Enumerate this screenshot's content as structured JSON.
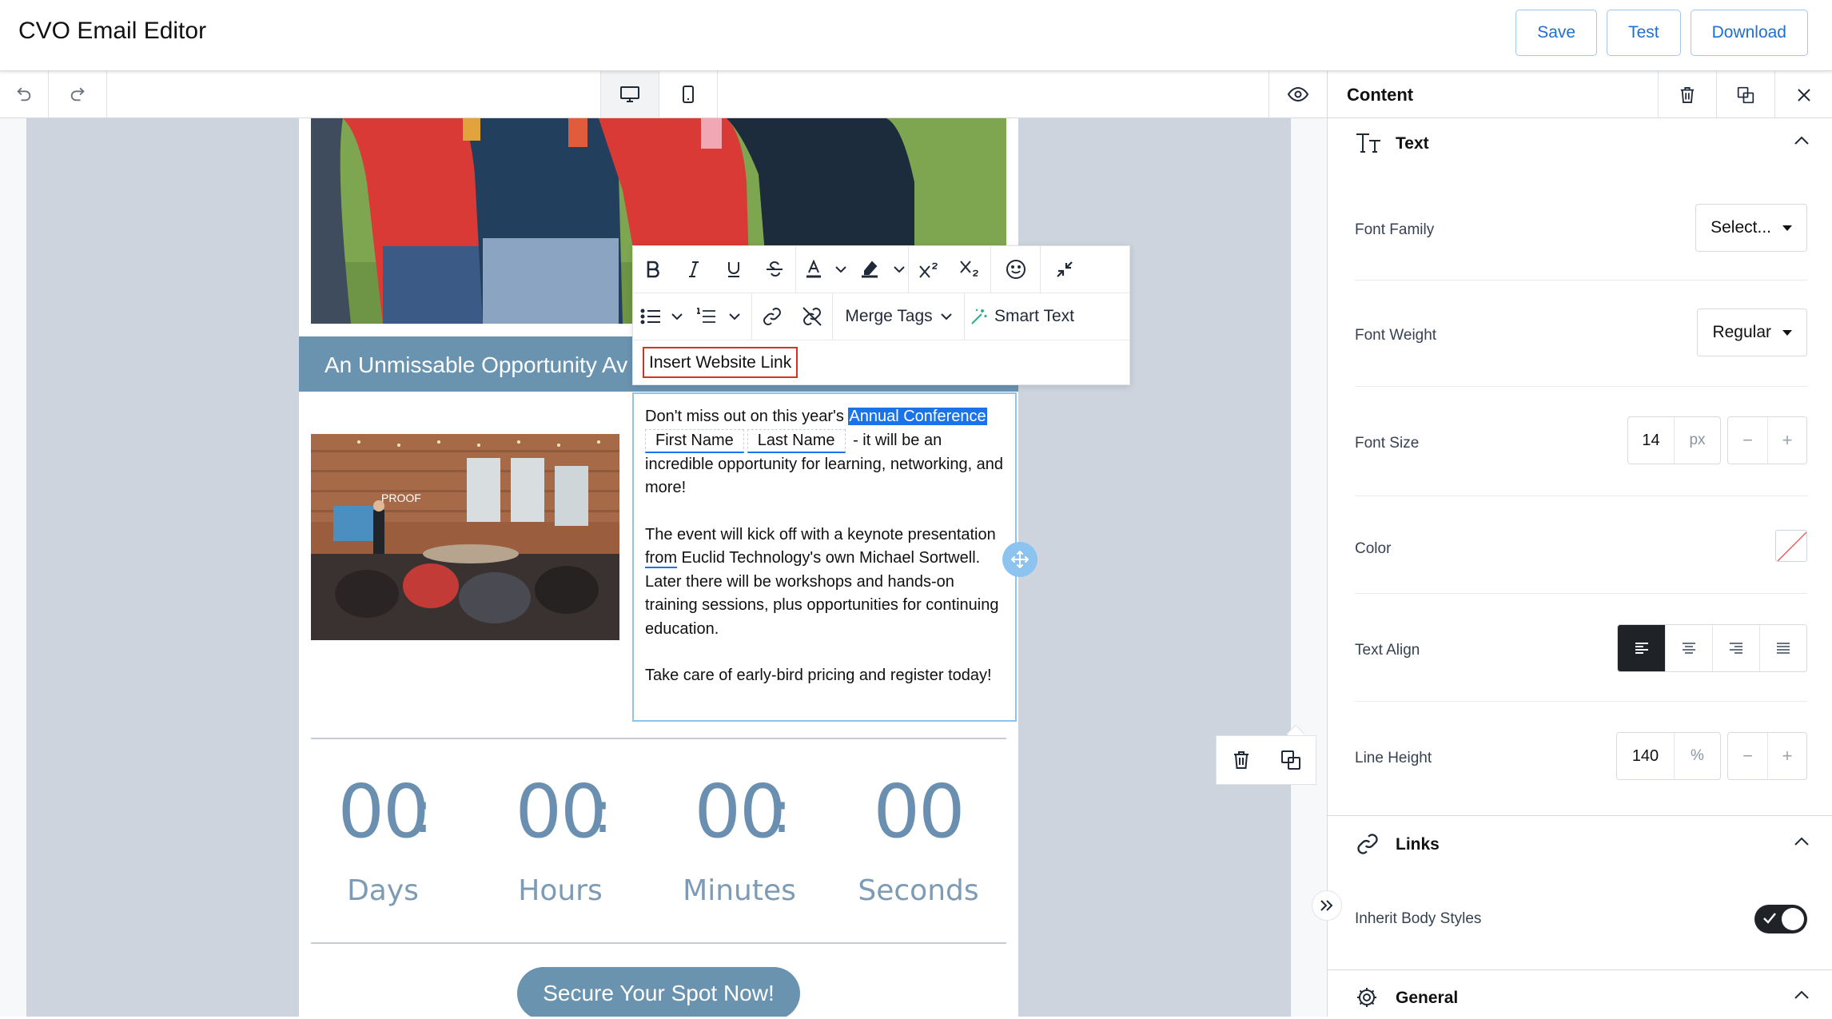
{
  "app": {
    "title": "CVO Email Editor"
  },
  "header": {
    "save_label": "Save",
    "test_label": "Test",
    "download_label": "Download"
  },
  "rte_toolbar": {
    "merge_tags_label": "Merge Tags",
    "smart_text_label": "Smart Text",
    "link_input_placeholder": "Insert Website Link"
  },
  "email": {
    "banner_text": "An Unmissable Opportunity Av",
    "body": {
      "p1_prefix": "Don't miss out on this year's ",
      "p1_selected": "Annual Conference",
      "merge_tag_first": "First Name",
      "merge_tag_last": "Last Name",
      "p1_suffix": " - it will be an incredible opportunity for learning, networking, and more!",
      "p2_prefix": "The event will kick off with a keynote presentation ",
      "p2_link": "from",
      "p2_suffix": " Euclid Technology's own Michael Sortwell.  Later there will be workshops and hands-on training sessions, plus opportunities for continuing education.",
      "p3": "Take care of early-bird pricing and register today!"
    },
    "countdown": {
      "units": [
        {
          "value": "00",
          "label": "Days"
        },
        {
          "value": "00",
          "label": "Hours"
        },
        {
          "value": "00",
          "label": "Minutes"
        },
        {
          "value": "00",
          "label": "Seconds"
        }
      ],
      "separator": ":"
    },
    "cta_label": "Secure Your Spot Now!",
    "photo_sign_text": "PROOF"
  },
  "panel": {
    "title": "Content",
    "text_section": {
      "title": "Text",
      "font_family_label": "Font Family",
      "font_family_value": "Select...",
      "font_weight_label": "Font Weight",
      "font_weight_value": "Regular",
      "font_size_label": "Font Size",
      "font_size_value": "14",
      "font_size_unit": "px",
      "color_label": "Color",
      "text_align_label": "Text Align",
      "text_align_active": "left",
      "line_height_label": "Line Height",
      "line_height_value": "140",
      "line_height_unit": "%",
      "minus": "−",
      "plus": "+"
    },
    "links_section": {
      "title": "Links",
      "inherit_label": "Inherit Body Styles",
      "inherit_on": true
    },
    "general_section": {
      "title": "General"
    }
  },
  "colors": {
    "accent_blue": "#1f6fd1",
    "banner": "#6a93b0",
    "selection": "#1a73e8",
    "canvas": "#cdd4dd",
    "link_input_border": "#d93025"
  }
}
